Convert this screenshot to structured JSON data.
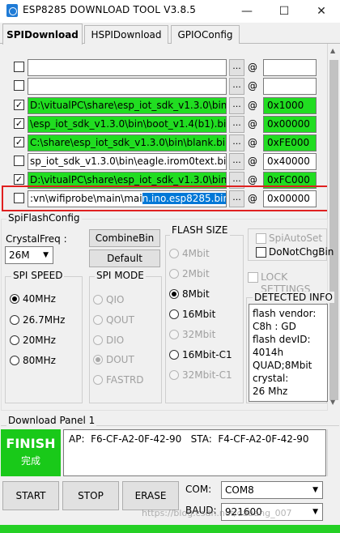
{
  "window": {
    "title": "ESP8285 DOWNLOAD TOOL V3.8.5",
    "minimize_glyph": "—",
    "maximize_glyph": "☐",
    "close_glyph": "✕"
  },
  "tabs": [
    {
      "label": "SPIDownload",
      "active": true
    },
    {
      "label": "HSPIDownload",
      "active": false
    },
    {
      "label": "GPIOConfig",
      "active": false
    }
  ],
  "files": [
    {
      "checked": false,
      "path": "",
      "address": "",
      "green": false
    },
    {
      "checked": false,
      "path": "",
      "address": "",
      "green": false
    },
    {
      "checked": true,
      "path": "D:\\vitualPC\\share\\esp_iot_sdk_v1.3.0\\bin\\",
      "address": "0x1000",
      "green": true
    },
    {
      "checked": true,
      "path": "\\esp_iot_sdk_v1.3.0\\bin\\boot_v1.4(b1).bin",
      "address": "0x00000",
      "green": true
    },
    {
      "checked": true,
      "path": "C:\\share\\esp_iot_sdk_v1.3.0\\bin\\blank.bin",
      "address": "0xFE000",
      "green": true
    },
    {
      "checked": false,
      "path": "sp_iot_sdk_v1.3.0\\bin\\eagle.irom0text.bin",
      "address": "0x40000",
      "green": false
    },
    {
      "checked": true,
      "path": "D:\\vitualPC\\share\\esp_iot_sdk_v1.3.0\\bin\\",
      "address": "0xFC000",
      "green": true
    },
    {
      "checked": false,
      "path_plain": ":vn\\wifiprobe\\main\\mai",
      "path_selected": "n.ino.esp8285.bin",
      "address": "0x00000",
      "green": false
    }
  ],
  "browse_label": "...",
  "at_symbol": "@",
  "checkmark": "✓",
  "spi_flash_config": {
    "title": "SpiFlashConfig",
    "crystal_label": "CrystalFreq :",
    "crystal_value": "26M",
    "combine_button": "CombineBin",
    "default_button": "Default",
    "spi_speed": {
      "title": "SPI SPEED",
      "options": [
        "40MHz",
        "26.7MHz",
        "20MHz",
        "80MHz"
      ],
      "selected": "40MHz"
    },
    "spi_mode": {
      "title": "SPI MODE",
      "options": [
        "QIO",
        "QOUT",
        "DIO",
        "DOUT",
        "FASTRD"
      ],
      "selected": "DOUT",
      "disabled": true
    },
    "flash_size": {
      "title": "FLASH SIZE",
      "options": [
        "4Mbit",
        "2Mbit",
        "8Mbit",
        "16Mbit",
        "32Mbit",
        "16Mbit-C1",
        "32Mbit-C1"
      ],
      "selected": "8Mbit",
      "enabled": [
        "8Mbit",
        "16Mbit",
        "16Mbit-C1"
      ]
    },
    "spi_auto_set": "SpiAutoSet",
    "do_not_chg_bin": "DoNotChgBin",
    "lock_settings": "LOCK SETTINGS",
    "detected_info_title": "DETECTED INFO",
    "detected_info": [
      "flash vendor:",
      "C8h : GD",
      "flash devID:",
      "4014h",
      "QUAD;8Mbit",
      "crystal:",
      "26 Mhz"
    ]
  },
  "download_panel": {
    "title": "Download Panel 1",
    "status": "FINISH",
    "status_cn": "完成",
    "status_color": "#19c919",
    "info": "AP:  F6-CF-A2-0F-42-90   STA:  F4-CF-A2-0F-42-90"
  },
  "controls": {
    "start": "START",
    "stop": "STOP",
    "erase": "ERASE",
    "com_label": "COM:",
    "com_value": "COM8",
    "baud_label": "BAUD:",
    "baud_value": "921600"
  },
  "watermark": "https://blog.csdn.net/dabang_007"
}
